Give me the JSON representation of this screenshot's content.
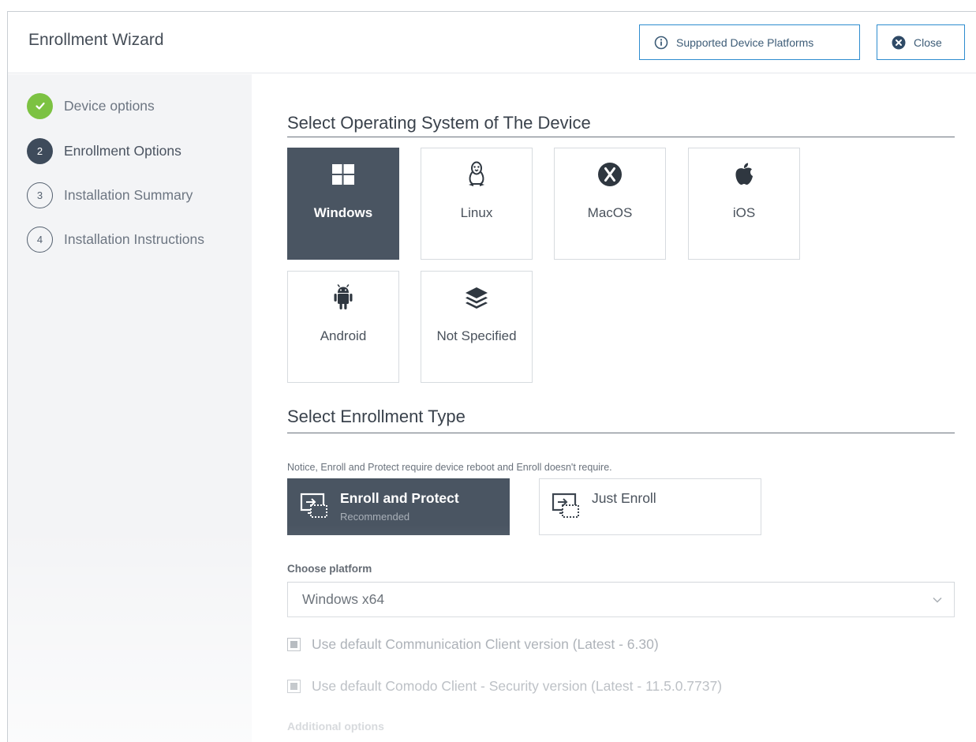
{
  "header": {
    "title": "Enrollment Wizard",
    "supported_label": "Supported Device Platforms",
    "close_label": "Close"
  },
  "steps": [
    {
      "number": "✓",
      "label": "Device options",
      "state": "done"
    },
    {
      "number": "2",
      "label": "Enrollment Options",
      "state": "active"
    },
    {
      "number": "3",
      "label": "Installation Summary",
      "state": "todo"
    },
    {
      "number": "4",
      "label": "Installation Instructions",
      "state": "todo"
    }
  ],
  "os_section": {
    "title": "Select Operating System of The Device",
    "options": [
      {
        "label": "Windows",
        "icon": "windows-icon",
        "selected": true
      },
      {
        "label": "Linux",
        "icon": "linux-icon",
        "selected": false
      },
      {
        "label": "MacOS",
        "icon": "macos-x-icon",
        "selected": false
      },
      {
        "label": "iOS",
        "icon": "apple-icon",
        "selected": false
      },
      {
        "label": "Android",
        "icon": "android-icon",
        "selected": false
      },
      {
        "label": "Not Specified",
        "icon": "layers-icon",
        "selected": false
      }
    ]
  },
  "enroll_section": {
    "title": "Select Enrollment Type",
    "notice": "Notice, Enroll and Protect require device reboot and Enroll doesn't require.",
    "options": [
      {
        "label": "Enroll and Protect",
        "sub": "Recommended",
        "selected": true
      },
      {
        "label": "Just Enroll",
        "sub": "",
        "selected": false
      }
    ]
  },
  "platform": {
    "label": "Choose platform",
    "value": "Windows x64"
  },
  "checkboxes": [
    {
      "label": "Use default Communication Client version (Latest - 6.30)",
      "checked": true
    },
    {
      "label": "Use default Comodo Client - Security version (Latest - 11.5.0.7737)",
      "checked": true
    }
  ],
  "additional_label": "Additional options",
  "colors": {
    "accent_border": "#2e8ccf",
    "selected_tile": "#4a5562",
    "done_step": "#7cc242",
    "active_step": "#3e4b5b"
  }
}
